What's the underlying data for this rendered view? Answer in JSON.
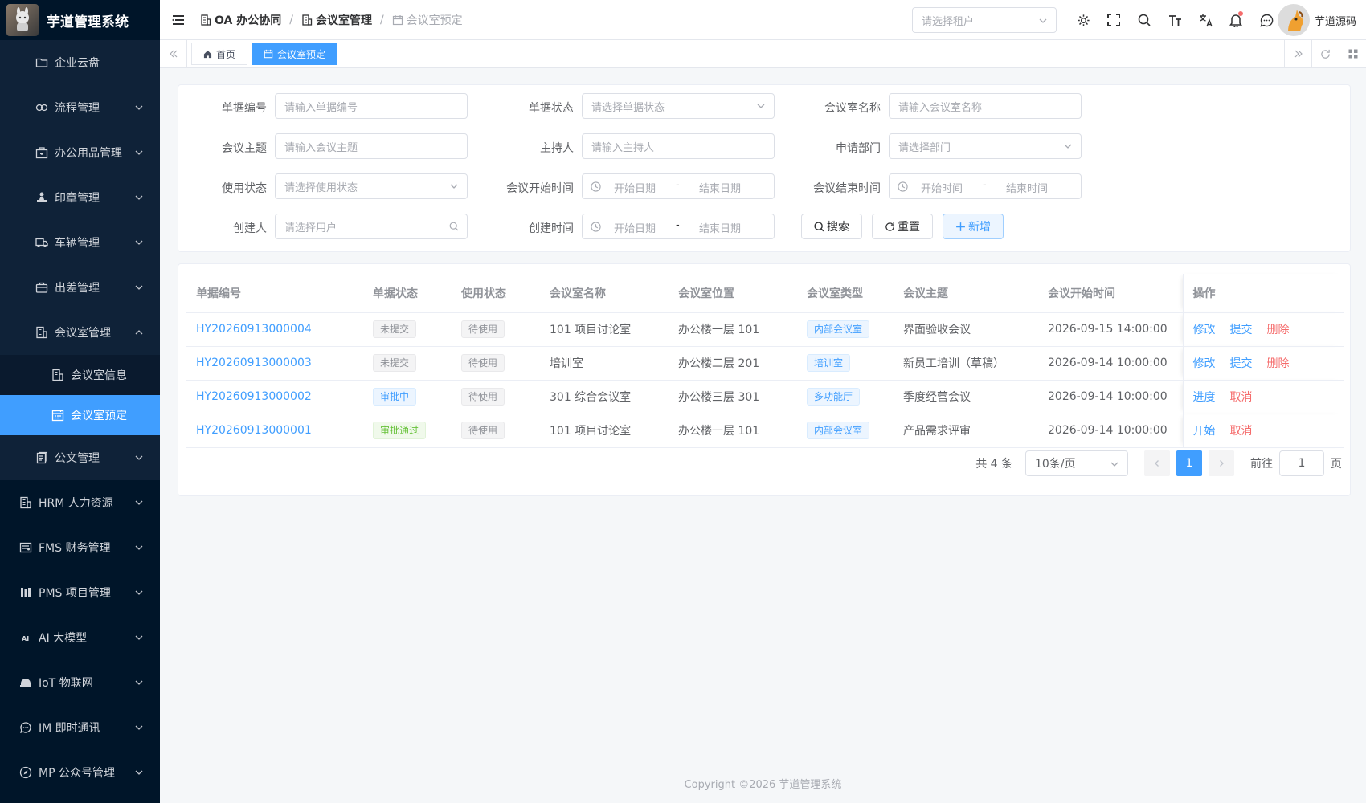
{
  "app": {
    "title": "芋道管理系统"
  },
  "sidebar": {
    "items": [
      {
        "label": "企业云盘",
        "icon": "folder-icon",
        "level": 1
      },
      {
        "label": "流程管理",
        "icon": "flow-icon",
        "level": 1,
        "expandable": true
      },
      {
        "label": "办公用品管理",
        "icon": "box-icon",
        "level": 1,
        "expandable": true
      },
      {
        "label": "印章管理",
        "icon": "stamp-icon",
        "level": 1,
        "expandable": true
      },
      {
        "label": "车辆管理",
        "icon": "truck-icon",
        "level": 1,
        "expandable": true
      },
      {
        "label": "出差管理",
        "icon": "briefcase-icon",
        "level": 1,
        "expandable": true
      },
      {
        "label": "会议室管理",
        "icon": "building-icon",
        "level": 1,
        "expandable": true,
        "expanded": true
      },
      {
        "label": "会议室信息",
        "icon": "building-icon",
        "level": 2
      },
      {
        "label": "会议室预定",
        "icon": "calendar-icon",
        "level": 2,
        "active": true
      },
      {
        "label": "公文管理",
        "icon": "document-icon",
        "level": 1,
        "expandable": true
      },
      {
        "label": "HRM 人力资源",
        "icon": "building-icon",
        "level": 0,
        "expandable": true
      },
      {
        "label": "FMS 财务管理",
        "icon": "finance-icon",
        "level": 0,
        "expandable": true
      },
      {
        "label": "PMS 项目管理",
        "icon": "project-icon",
        "level": 0,
        "expandable": true
      },
      {
        "label": "AI 大模型",
        "icon": "ai-icon",
        "level": 0,
        "expandable": true
      },
      {
        "label": "IoT 物联网",
        "icon": "iot-icon",
        "level": 0,
        "expandable": true
      },
      {
        "label": "IM 即时通讯",
        "icon": "chat-icon",
        "level": 0,
        "expandable": true
      },
      {
        "label": "MP 公众号管理",
        "icon": "compass-icon",
        "level": 0,
        "expandable": true
      }
    ]
  },
  "header": {
    "breadcrumb": [
      "OA 办公协同",
      "会议室管理",
      "会议室预定"
    ],
    "tenant_placeholder": "请选择租户",
    "icons": [
      "settings-icon",
      "fullscreen-icon",
      "search-icon",
      "font-size-icon",
      "translate-icon",
      "bell-icon",
      "message-icon"
    ],
    "username": "芋道源码"
  },
  "tags": {
    "items": [
      "首页",
      "会议室预定"
    ],
    "active": "会议室预定"
  },
  "search": {
    "fields": {
      "bill_no": {
        "label": "单据编号",
        "placeholder": "请输入单据编号"
      },
      "bill_status": {
        "label": "单据状态",
        "placeholder": "请选择单据状态"
      },
      "room_name": {
        "label": "会议室名称",
        "placeholder": "请输入会议室名称"
      },
      "topic": {
        "label": "会议主题",
        "placeholder": "请输入会议主题"
      },
      "host": {
        "label": "主持人",
        "placeholder": "请输入主持人"
      },
      "dept": {
        "label": "申请部门",
        "placeholder": "请选择部门"
      },
      "use_status": {
        "label": "使用状态",
        "placeholder": "请选择使用状态"
      },
      "start_time": {
        "label": "会议开始时间",
        "from": "开始日期",
        "to": "结束日期"
      },
      "end_time": {
        "label": "会议结束时间",
        "from": "开始时间",
        "to": "结束时间"
      },
      "creator": {
        "label": "创建人",
        "placeholder": "请选择用户"
      },
      "create_time": {
        "label": "创建时间",
        "from": "开始日期",
        "to": "结束日期"
      }
    },
    "range_sep": "-",
    "buttons": {
      "search": "搜索",
      "reset": "重置",
      "add": "新增"
    }
  },
  "table": {
    "columns": [
      "单据编号",
      "单据状态",
      "使用状态",
      "会议室名称",
      "会议室位置",
      "会议室类型",
      "会议主题",
      "会议开始时间",
      "操作"
    ],
    "rows": [
      {
        "bill_no": "HY20260913000004",
        "bill_status": "未提交",
        "bill_status_type": "info",
        "use_status": "待使用",
        "room_name": "101 项目讨论室",
        "location": "办公楼一层 101",
        "room_type": "内部会议室",
        "topic": "界面验收会议",
        "start_time": "2026-09-15 14:00:00",
        "actions": [
          {
            "label": "修改",
            "color": "blue"
          },
          {
            "label": "提交",
            "color": "blue"
          },
          {
            "label": "删除",
            "color": "red"
          }
        ]
      },
      {
        "bill_no": "HY20260913000003",
        "bill_status": "未提交",
        "bill_status_type": "info",
        "use_status": "待使用",
        "room_name": "培训室",
        "location": "办公楼二层 201",
        "room_type": "培训室",
        "topic": "新员工培训（草稿）",
        "start_time": "2026-09-14 10:00:00",
        "actions": [
          {
            "label": "修改",
            "color": "blue"
          },
          {
            "label": "提交",
            "color": "blue"
          },
          {
            "label": "删除",
            "color": "red"
          }
        ]
      },
      {
        "bill_no": "HY20260913000002",
        "bill_status": "审批中",
        "bill_status_type": "primary",
        "use_status": "待使用",
        "room_name": "301 综合会议室",
        "location": "办公楼三层 301",
        "room_type": "多功能厅",
        "topic": "季度经营会议",
        "start_time": "2026-09-14 10:00:00",
        "actions": [
          {
            "label": "进度",
            "color": "blue"
          },
          {
            "label": "取消",
            "color": "red"
          }
        ]
      },
      {
        "bill_no": "HY20260913000001",
        "bill_status": "审批通过",
        "bill_status_type": "success",
        "use_status": "待使用",
        "room_name": "101 项目讨论室",
        "location": "办公楼一层 101",
        "room_type": "内部会议室",
        "topic": "产品需求评审",
        "start_time": "2026-09-14 10:00:00",
        "actions": [
          {
            "label": "开始",
            "color": "blue"
          },
          {
            "label": "取消",
            "color": "red"
          }
        ]
      }
    ]
  },
  "pagination": {
    "total": "共 4 条",
    "page_size": "10条/页",
    "current_page": "1",
    "goto_label": "前往",
    "goto_value": "1",
    "page_suffix": "页"
  },
  "footer": {
    "copyright": "Copyright ©2026 芋道管理系统"
  },
  "colors": {
    "primary": "#409eff",
    "sidebar_bg": "#001529",
    "danger": "#f56c6c",
    "success": "#67c23a"
  }
}
